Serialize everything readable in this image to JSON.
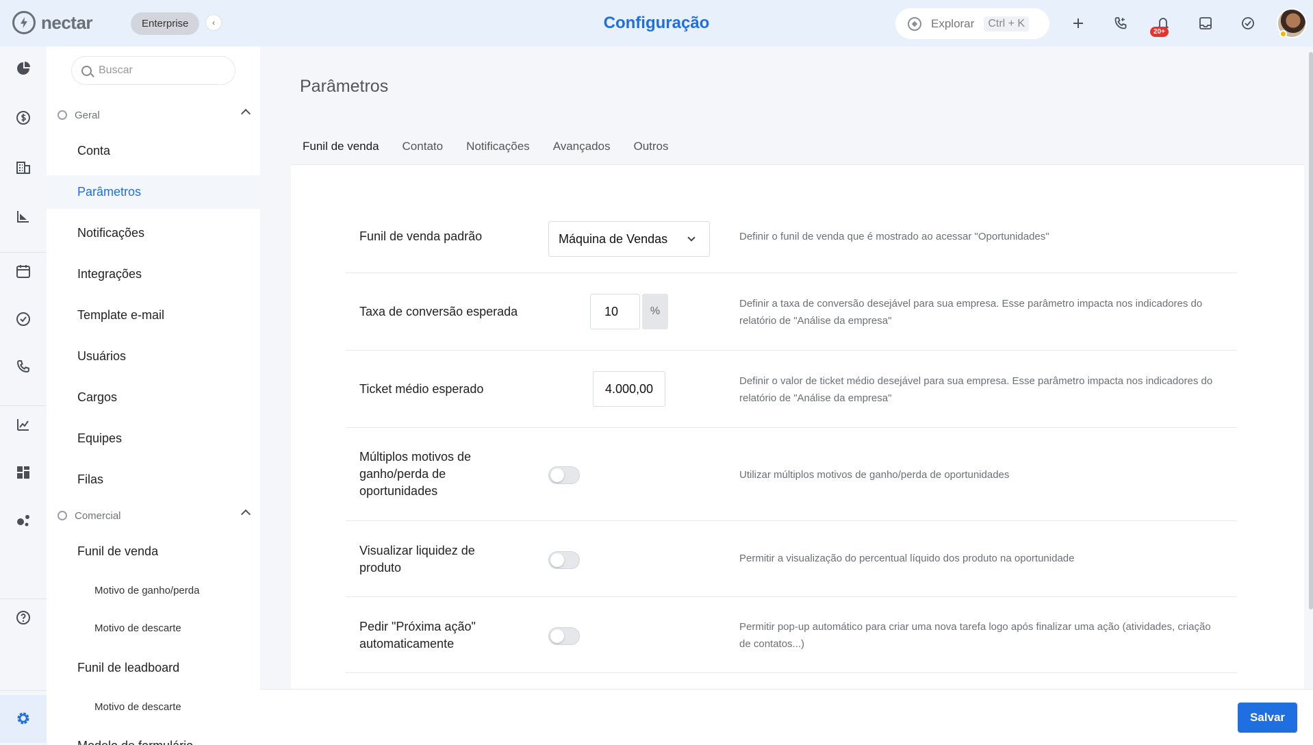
{
  "brand": {
    "name": "nectar",
    "plan": "Enterprise"
  },
  "header": {
    "title": "Configuração",
    "explore_label": "Explorar",
    "explore_shortcut": "Ctrl + K",
    "notification_count": "20+"
  },
  "rail": {
    "icons": [
      "dashboard-icon",
      "money-icon",
      "building-icon",
      "chart-icon",
      "calendar-icon",
      "check-icon",
      "phone-icon",
      "stats-icon",
      "widgets-icon",
      "share-icon",
      "help-icon",
      "settings-icon",
      "expand-icon"
    ]
  },
  "sidebar": {
    "search_placeholder": "Buscar",
    "sections": [
      {
        "label": "Geral",
        "items": [
          "Conta",
          "Parâmetros",
          "Notificações",
          "Integrações",
          "Template e-mail",
          "Usuários",
          "Cargos",
          "Equipes",
          "Filas"
        ]
      },
      {
        "label": "Comercial",
        "items": [
          "Funil de venda",
          "Motivo de ganho/perda",
          "Motivo de descarte",
          "Funil de leadboard",
          "Motivo de descarte",
          "Modelo de formulário"
        ]
      }
    ],
    "active_item": "Parâmetros"
  },
  "main": {
    "page_title": "Parâmetros",
    "tabs": [
      "Funil de venda",
      "Contato",
      "Notificações",
      "Avançados",
      "Outros"
    ],
    "active_tab": "Funil de venda",
    "rows": [
      {
        "label": "Funil de venda padrão",
        "value": "Máquina de Vendas",
        "description": "Definir o funil de venda que é mostrado ao acessar \"Oportunidades\""
      },
      {
        "label": "Taxa de conversão esperada",
        "value": "10",
        "suffix": "%",
        "description": "Definir a taxa de conversão desejável para sua empresa. Esse parâmetro impacta nos indicadores do relatório de \"Análise da empresa\""
      },
      {
        "label": "Ticket médio esperado",
        "value": "4.000,00",
        "description": "Definir o valor de ticket médio desejável para sua empresa. Esse parâmetro impacta nos indicadores do relatório de \"Análise da empresa\""
      },
      {
        "label": "Múltiplos motivos de ganho/perda de oportunidades",
        "toggle": false,
        "description": "Utilizar múltiplos motivos de ganho/perda de oportunidades"
      },
      {
        "label": "Visualizar liquidez de produto",
        "toggle": false,
        "description": "Permitir a visualização do percentual líquido dos produto na oportunidade"
      },
      {
        "label": "Pedir \"Próxima ação\" automaticamente",
        "toggle": false,
        "description": "Permitir pop-up automático para criar uma nova tarefa logo após finalizar uma ação (atividades, criação de contatos...)"
      }
    ]
  },
  "footer": {
    "save_label": "Salvar"
  },
  "colors": {
    "accent": "#1f6fe0",
    "header_bg": "#e7f0fb",
    "badge": "#e3342f"
  }
}
